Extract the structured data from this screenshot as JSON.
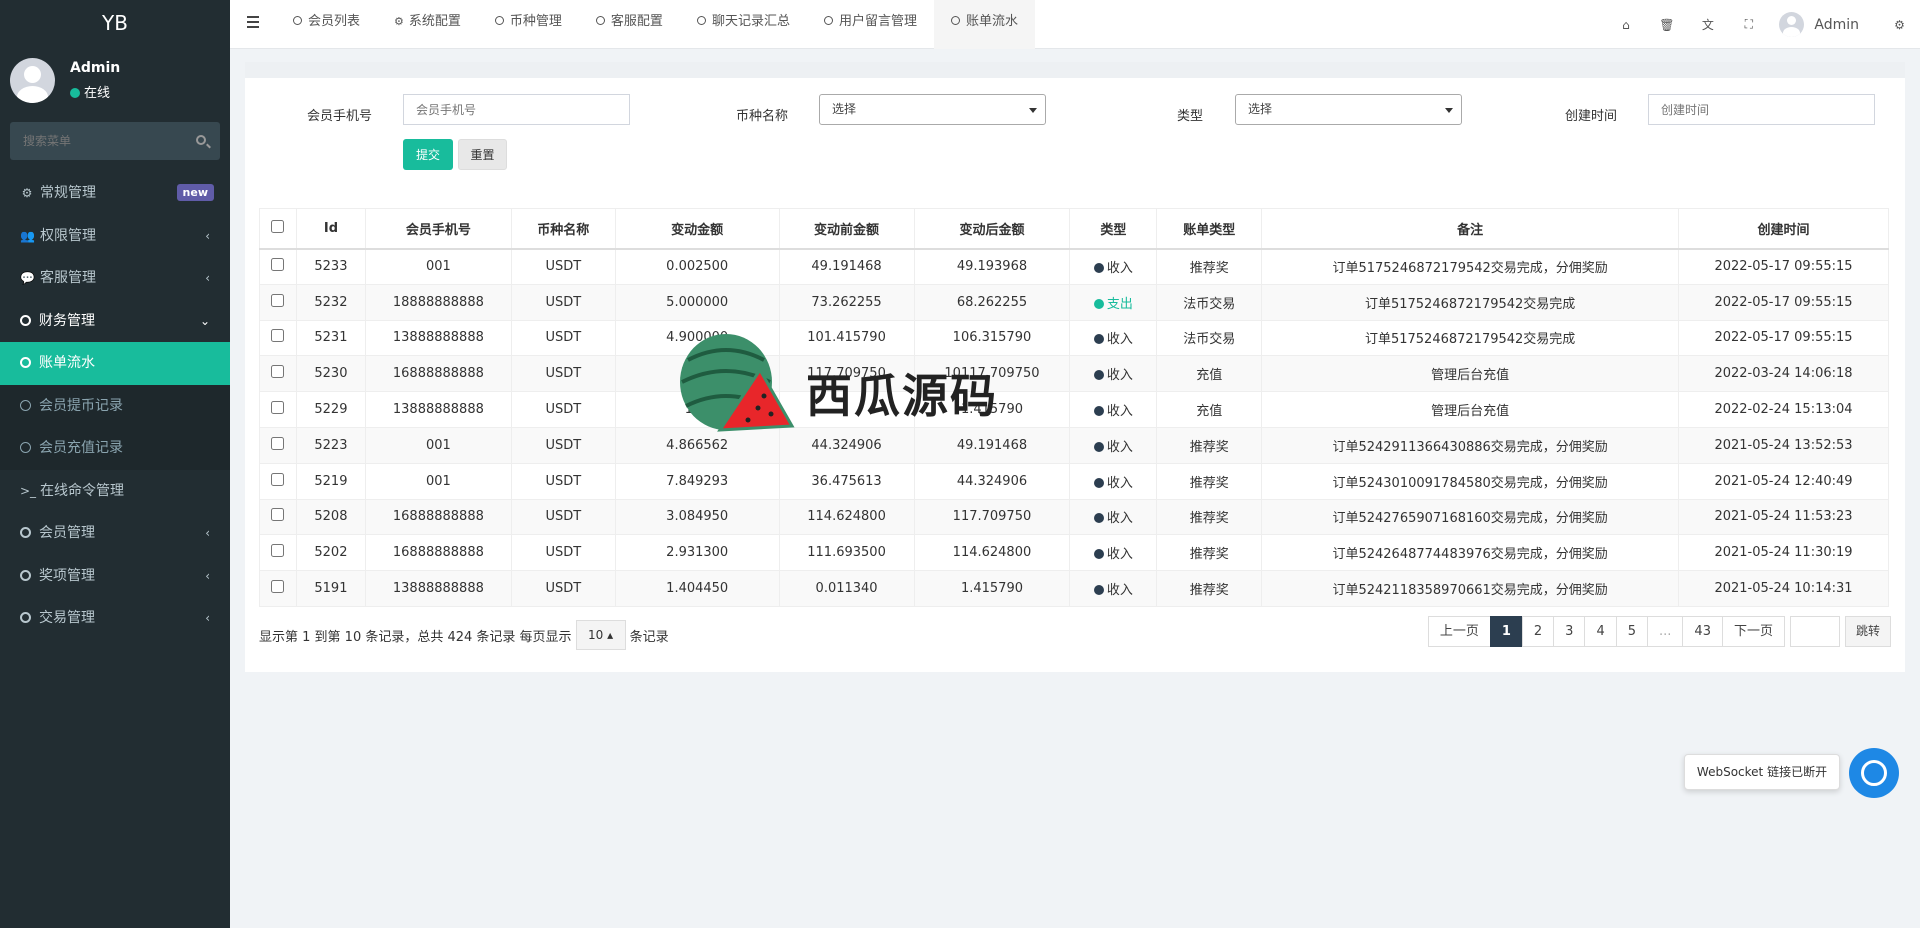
{
  "sidebar": {
    "logo": "YB",
    "user_name": "Admin",
    "user_status": "在线",
    "search_placeholder": "搜索菜单",
    "menu": {
      "general": "常规管理",
      "general_badge": "new",
      "auth": "权限管理",
      "service": "客服管理",
      "finance": "财务管理",
      "finance_sub": [
        "账单流水",
        "会员提币记录",
        "会员充值记录"
      ],
      "online_cmd": "在线命令管理",
      "member": "会员管理",
      "prize": "奖项管理",
      "trade": "交易管理"
    }
  },
  "topbar": {
    "tabs": [
      "会员列表",
      "系统配置",
      "币种管理",
      "客服配置",
      "聊天记录汇总",
      "用户留言管理",
      "账单流水"
    ],
    "user_name": "Admin",
    "icons": [
      "home-icon",
      "trash-icon",
      "translate-icon",
      "fullscreen-icon",
      "user-avatar",
      "settings-icon"
    ]
  },
  "filter": {
    "phone_label": "会员手机号",
    "phone_placeholder": "会员手机号",
    "coin_label": "币种名称",
    "coin_value": "选择",
    "type_label": "类型",
    "type_value": "选择",
    "time_label": "创建时间",
    "time_placeholder": "创建时间",
    "submit": "提交",
    "reset": "重置"
  },
  "table": {
    "headers": [
      "Id",
      "会员手机号",
      "币种名称",
      "变动金额",
      "变动前金额",
      "变动后金额",
      "类型",
      "账单类型",
      "备注",
      "创建时间"
    ],
    "rows": [
      {
        "id": "5233",
        "phone": "001",
        "coin": "USDT",
        "amount": "0.002500",
        "before": "49.191468",
        "after": "49.193968",
        "type": "收入",
        "bill": "推荐奖",
        "remark": "订单5175246872179542交易完成，分佣奖励",
        "time": "2022-05-17 09:55:15"
      },
      {
        "id": "5232",
        "phone": "18888888888",
        "coin": "USDT",
        "amount": "5.000000",
        "before": "73.262255",
        "after": "68.262255",
        "type": "支出",
        "bill": "法币交易",
        "remark": "订单5175246872179542交易完成",
        "time": "2022-05-17 09:55:15"
      },
      {
        "id": "5231",
        "phone": "13888888888",
        "coin": "USDT",
        "amount": "4.900000",
        "before": "101.415790",
        "after": "106.315790",
        "type": "收入",
        "bill": "法币交易",
        "remark": "订单5175246872179542交易完成",
        "time": "2022-05-17 09:55:15"
      },
      {
        "id": "5230",
        "phone": "16888888888",
        "coin": "USDT",
        "amount": "1000",
        "before": "117.709750",
        "after": "10117.709750",
        "type": "收入",
        "bill": "充值",
        "remark": "管理后台充值",
        "time": "2022-03-24 14:06:18"
      },
      {
        "id": "5229",
        "phone": "13888888888",
        "coin": "USDT",
        "amount": "100",
        "before": "",
        "after": "1.415790",
        "type": "收入",
        "bill": "充值",
        "remark": "管理后台充值",
        "time": "2022-02-24 15:13:04"
      },
      {
        "id": "5223",
        "phone": "001",
        "coin": "USDT",
        "amount": "4.866562",
        "before": "44.324906",
        "after": "49.191468",
        "type": "收入",
        "bill": "推荐奖",
        "remark": "订单5242911366430886交易完成，分佣奖励",
        "time": "2021-05-24 13:52:53"
      },
      {
        "id": "5219",
        "phone": "001",
        "coin": "USDT",
        "amount": "7.849293",
        "before": "36.475613",
        "after": "44.324906",
        "type": "收入",
        "bill": "推荐奖",
        "remark": "订单5243010091784580交易完成，分佣奖励",
        "time": "2021-05-24 12:40:49"
      },
      {
        "id": "5208",
        "phone": "16888888888",
        "coin": "USDT",
        "amount": "3.084950",
        "before": "114.624800",
        "after": "117.709750",
        "type": "收入",
        "bill": "推荐奖",
        "remark": "订单5242765907168160交易完成，分佣奖励",
        "time": "2021-05-24 11:53:23"
      },
      {
        "id": "5202",
        "phone": "16888888888",
        "coin": "USDT",
        "amount": "2.931300",
        "before": "111.693500",
        "after": "114.624800",
        "type": "收入",
        "bill": "推荐奖",
        "remark": "订单5242648774483976交易完成，分佣奖励",
        "time": "2021-05-24 11:30:19"
      },
      {
        "id": "5191",
        "phone": "13888888888",
        "coin": "USDT",
        "amount": "1.404450",
        "before": "0.011340",
        "after": "1.415790",
        "type": "收入",
        "bill": "推荐奖",
        "remark": "订单5242118358970661交易完成，分佣奖励",
        "time": "2021-05-24 10:14:31"
      }
    ]
  },
  "pagination": {
    "info_prefix": "显示第 1 到第 10 条记录，总共 424 条记录 每页显示",
    "page_size": "10",
    "info_suffix": "条记录",
    "prev": "上一页",
    "pages": [
      "1",
      "2",
      "3",
      "4",
      "5",
      "...",
      "43"
    ],
    "next": "下一页",
    "jump": "跳转"
  },
  "watermark": {
    "text": "西瓜源码"
  },
  "websocket": {
    "tip": "WebSocket 链接已断开"
  },
  "colors": {
    "accent": "#18bc9c",
    "sidebar": "#222d32",
    "income": "#2c3e50",
    "expense": "#18bc9c"
  }
}
